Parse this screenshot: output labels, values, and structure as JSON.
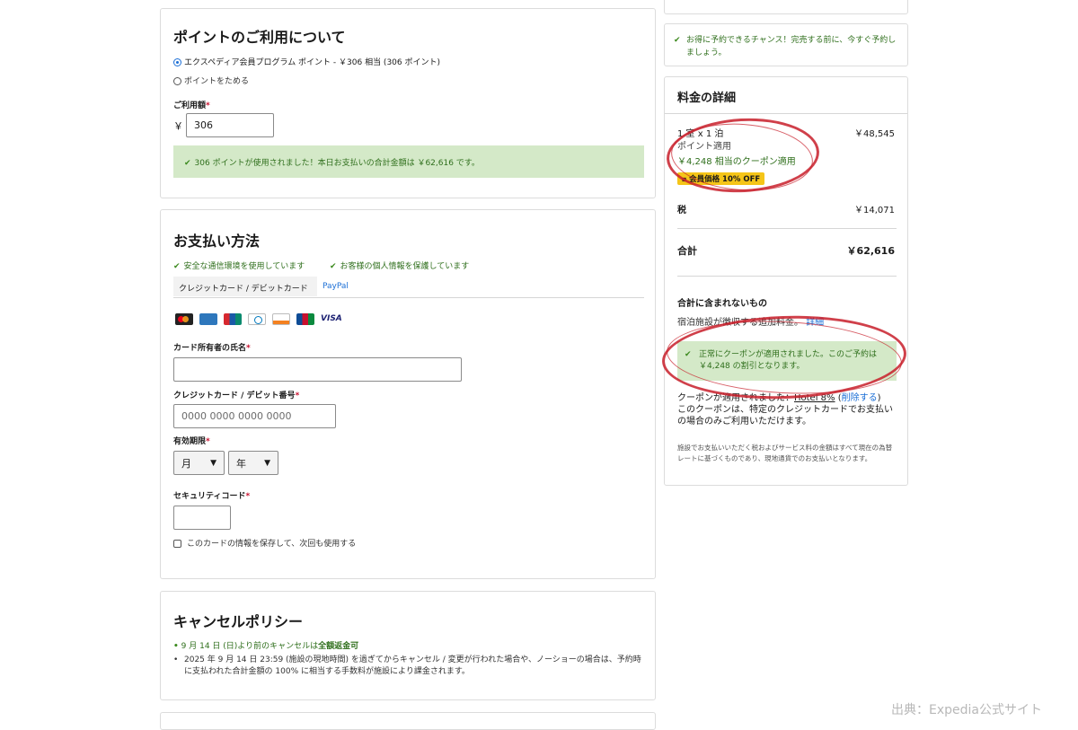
{
  "points": {
    "title": "ポイントのご利用について",
    "option1": "エクスペディア会員プログラム ポイント - ￥306 相当 (306 ポイント)",
    "option2": "ポイントをためる",
    "amount_label": "ご利用額",
    "currency": "￥",
    "amount_value": "306",
    "success_msg": "306 ポイントが使用されました！本日お支払いの合計金額は ￥62,616 です。"
  },
  "payment": {
    "title": "お支払い方法",
    "secure1": "安全な通信環境を使用しています",
    "secure2": "お客様の個人情報を保護しています",
    "tab_card": "クレジットカード / デビットカード",
    "tab_paypal": "PayPal",
    "card_brands": [
      "mastercard",
      "amex",
      "unionpay",
      "diners",
      "discover",
      "jcb",
      "VISA"
    ],
    "name_label": "カード所有者の氏名",
    "number_label": "クレジットカード / デビット番号",
    "number_placeholder": "0000 0000 0000 0000",
    "expiry_label": "有効期限",
    "month": "月",
    "year": "年",
    "cvv_label": "セキュリティコード",
    "save_card": "このカードの情報を保存して、次回も使用する",
    "required_mark": "*"
  },
  "cancel": {
    "title": "キャンセルポリシー",
    "item1_prefix": "9 月 14 日 (日)より前のキャンセルは",
    "item1_bold": "全額返金可",
    "item2": "2025 年 9 月 14 日 23:59 (施設の現地時間) を過ぎてからキャンセル / 変更が行われた場合や、ノーショーの場合は、予約時に支払われた合計金額の 100% に相当する手数料が施設により課金されます。"
  },
  "sidebar": {
    "chance_msg": "お得に予約できるチャンス！完売する前に、今すぐ予約しましょう。",
    "price_title": "料金の詳細",
    "room_line": "1 室 x 1 泊",
    "room_price": "￥48,545",
    "points_applied": "ポイント適用",
    "coupon_applied": "￥4,248 相当のクーポン適用",
    "member_badge": "会員価格 10% OFF",
    "tax_label": "税",
    "tax_value": "￥14,071",
    "total_label": "合計",
    "total_value": "￥62,616",
    "not_included_title": "合計に含まれないもの",
    "not_included_text": "宿泊施設が徴収する追加料金。",
    "details_link": "詳細",
    "coupon_success": "正常にクーポンが適用されました。このご予約は ￥4,248 の割引となります。",
    "coupon_applied_prefix": "クーポンが適用されました：",
    "coupon_name": "Hotel 8%",
    "coupon_remove": "削除する",
    "coupon_note": "このクーポンは、特定のクレジットカードでお支払いの場合のみご利用いただけます。",
    "fine_print": "施設でお支払いいただく税およびサービス料の金額はすべて現在の為替レートに基づくものであり、現地通貨でのお支払いとなります。"
  },
  "source": "出典：Expedia公式サイト",
  "colors": {
    "accent": "#1c6fd6",
    "success_bg": "#d4e9c8",
    "success_text": "#2f6f1c",
    "annotation": "#c81e2a",
    "badge": "#f5c518"
  }
}
